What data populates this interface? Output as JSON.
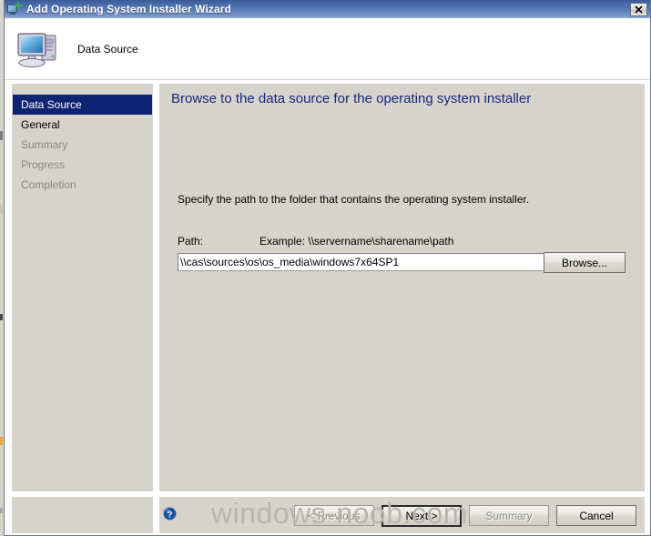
{
  "window": {
    "title": "Add Operating System Installer Wizard",
    "title_icon": "computer-add-icon",
    "close_label": "×",
    "titlebar_color": "#4568a6",
    "panel_color": "#d6d3cd"
  },
  "header": {
    "icon": "computer-icon",
    "title": "Data Source"
  },
  "sidebar": {
    "items": [
      {
        "label": "Data Source",
        "state": "selected"
      },
      {
        "label": "General",
        "state": "enabled"
      },
      {
        "label": "Summary",
        "state": "disabled"
      },
      {
        "label": "Progress",
        "state": "disabled"
      },
      {
        "label": "Completion",
        "state": "disabled"
      }
    ],
    "selected_color": "#0d2472"
  },
  "main": {
    "heading": "Browse to the data source for the operating system installer",
    "heading_color": "#18287a",
    "instruction": "Specify the path to the folder that contains the operating system installer.",
    "path_label": "Path:",
    "example_label": "Example: \\\\servername\\sharename\\path",
    "path_value": "\\\\cas\\sources\\os\\os_media\\windows7x64SP1",
    "path_placeholder": "",
    "browse_label": "Browse..."
  },
  "footer": {
    "help_icon": "help-question-icon",
    "buttons": [
      {
        "label": "< Previous",
        "state": "disabled"
      },
      {
        "label": "Next >",
        "state": "default"
      },
      {
        "label": "Summary",
        "state": "disabled"
      },
      {
        "label": "Cancel",
        "state": "enabled"
      }
    ]
  },
  "watermark": {
    "text": "windows-noob.com"
  }
}
